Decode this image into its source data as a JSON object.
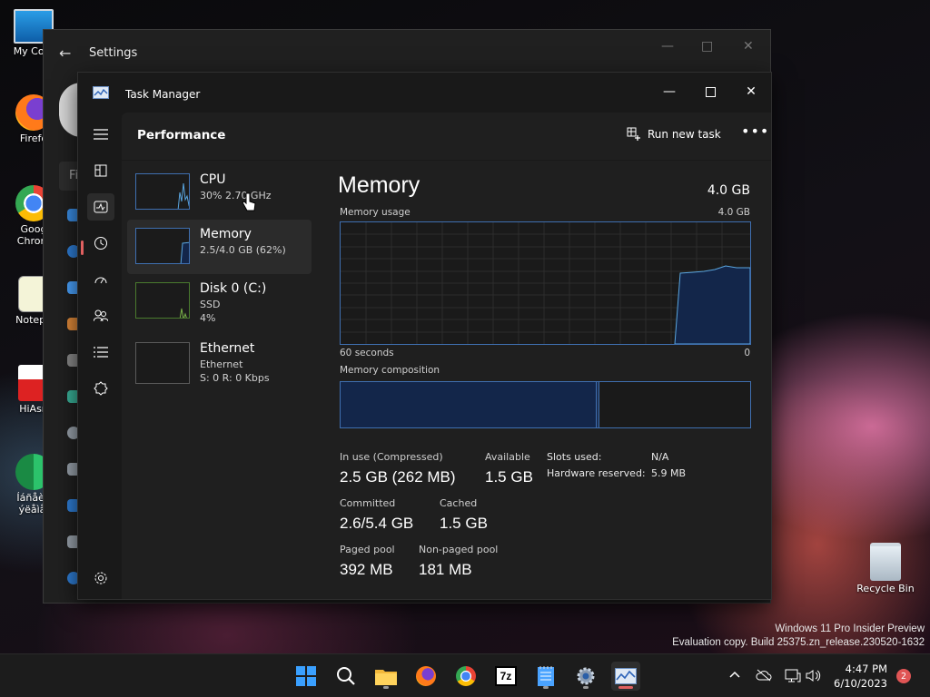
{
  "desktop": {
    "icons": [
      {
        "label": "My Com"
      },
      {
        "label": "Firefo"
      },
      {
        "label": "Goog Chrom"
      },
      {
        "label": "Notepa"
      },
      {
        "label": "HiAsn"
      },
      {
        "label": "Íáñåèá ýëåìåí"
      },
      {
        "label": "Recycle Bin"
      }
    ],
    "watermark_line1": "Windows 11 Pro Insider Preview",
    "watermark_line2": "Evaluation copy. Build 25375.zn_release.230520-1632"
  },
  "settings_window": {
    "title": "Settings",
    "search_placeholder": "Fi"
  },
  "task_manager": {
    "title": "Task Manager",
    "page_title": "Performance",
    "run_new_task": "Run new task",
    "more": "•••",
    "resources": [
      {
        "name": "CPU",
        "line1": "30%  2.70 GHz",
        "line2": ""
      },
      {
        "name": "Memory",
        "line1": "2.5/4.0 GB (62%)",
        "line2": ""
      },
      {
        "name": "Disk 0 (C:)",
        "line1": "SSD",
        "line2": "4%"
      },
      {
        "name": "Ethernet",
        "line1": "Ethernet",
        "line2": "S: 0  R: 0 Kbps"
      }
    ],
    "detail": {
      "title": "Memory",
      "total": "4.0 GB",
      "usage_label": "Memory usage",
      "usage_max": "4.0 GB",
      "time_left": "60 seconds",
      "time_right": "0",
      "composition_label": "Memory composition",
      "stats": {
        "in_use_label": "In use (Compressed)",
        "in_use_value": "2.5 GB (262 MB)",
        "available_label": "Available",
        "available_value": "1.5 GB",
        "committed_label": "Committed",
        "committed_value": "2.6/5.4 GB",
        "cached_label": "Cached",
        "cached_value": "1.5 GB",
        "paged_label": "Paged pool",
        "paged_value": "392 MB",
        "nonpaged_label": "Non-paged pool",
        "nonpaged_value": "181 MB",
        "slots_label": "Slots used:",
        "slots_value": "N/A",
        "hw_label": "Hardware reserved:",
        "hw_value": "5.9 MB"
      }
    },
    "nav_icons": [
      "hamburger-icon",
      "processes-icon",
      "performance-icon",
      "app-history-icon",
      "startup-apps-icon",
      "users-icon",
      "details-icon",
      "services-icon",
      "settings-icon"
    ]
  },
  "taskbar": {
    "time": "4:47 PM",
    "date": "6/10/2023",
    "notification_count": "2",
    "apps": [
      "start-icon",
      "search-icon",
      "file-explorer-icon",
      "firefox-icon",
      "chrome-icon",
      "7zip-icon",
      "notepad-icon",
      "settings-icon",
      "task-manager-icon"
    ],
    "seven_zip_label": "7z"
  },
  "colors": {
    "accent_blue": "#3f6fb0",
    "fill_blue": "#13264a",
    "active_indicator": "#e06060"
  }
}
